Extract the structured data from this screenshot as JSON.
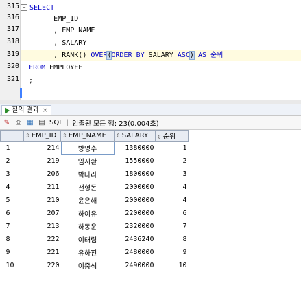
{
  "editor": {
    "line_numbers": [
      "315",
      "316",
      "317",
      "318",
      "319",
      "320",
      "321"
    ],
    "lines": [
      {
        "prefix": "",
        "parts": [
          {
            "t": "SELECT",
            "cls": "kw"
          }
        ]
      },
      {
        "prefix": "        ",
        "parts": [
          {
            "t": "EMP_ID",
            "cls": ""
          }
        ]
      },
      {
        "prefix": "        ",
        "parts": [
          {
            "t": ", EMP_NAME",
            "cls": ""
          }
        ]
      },
      {
        "prefix": "        ",
        "parts": [
          {
            "t": ", SALARY",
            "cls": ""
          }
        ]
      },
      {
        "prefix": "        ",
        "parts": [
          {
            "t": ", RANK() ",
            "cls": ""
          },
          {
            "t": "OVER",
            "cls": "kw"
          },
          {
            "t": "(",
            "cls": "paren"
          },
          {
            "t": "ORDER BY",
            "cls": "kw"
          },
          {
            "t": " SALARY ",
            "cls": ""
          },
          {
            "t": "ASC",
            "cls": "kw"
          },
          {
            "t": ")",
            "cls": "paren"
          },
          {
            "t": " AS ",
            "cls": "kw"
          },
          {
            "t": "순위",
            "cls": "kr"
          }
        ]
      },
      {
        "prefix": "  ",
        "parts": [
          {
            "t": "FROM",
            "cls": "kw"
          },
          {
            "t": " EMPLOYEE",
            "cls": ""
          }
        ]
      },
      {
        "prefix": "  ",
        "parts": [
          {
            "t": ";",
            "cls": ""
          }
        ]
      }
    ]
  },
  "results": {
    "tab_label": "질의 결과",
    "close_glyph": "×",
    "toolbar": {
      "sql_label": "SQL",
      "separator": "|",
      "fetch_status": "인출된 모든 행: 23(0.004초)"
    },
    "columns": [
      "",
      "EMP_ID",
      "EMP_NAME",
      "SALARY",
      "순위"
    ],
    "rows": [
      [
        "1",
        "214",
        "방명수",
        "1380000",
        "1"
      ],
      [
        "2",
        "219",
        "임시환",
        "1550000",
        "2"
      ],
      [
        "3",
        "206",
        "박나라",
        "1800000",
        "3"
      ],
      [
        "4",
        "211",
        "전형돈",
        "2000000",
        "4"
      ],
      [
        "5",
        "210",
        "윤은해",
        "2000000",
        "4"
      ],
      [
        "6",
        "207",
        "하이유",
        "2200000",
        "6"
      ],
      [
        "7",
        "213",
        "하동운",
        "2320000",
        "7"
      ],
      [
        "8",
        "222",
        "이태림",
        "2436240",
        "8"
      ],
      [
        "9",
        "221",
        "유하진",
        "2480000",
        "9"
      ],
      [
        "10",
        "220",
        "이중석",
        "2490000",
        "10"
      ]
    ]
  },
  "colors": {
    "keyword": "#0000c8",
    "current_line": "#fffbe0",
    "header_bg": "#e8ecf3"
  }
}
